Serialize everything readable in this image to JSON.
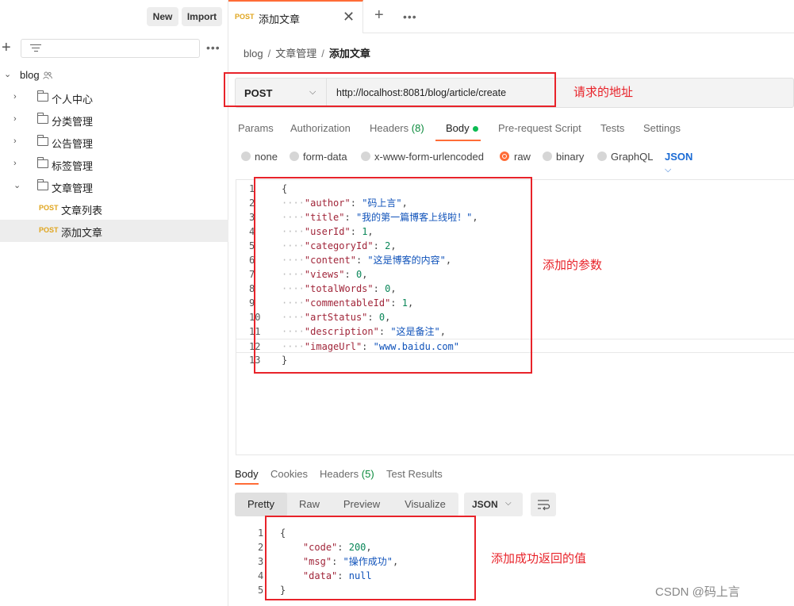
{
  "sidebar": {
    "new_label": "New",
    "import_label": "Import",
    "more": "•••",
    "collection": "blog",
    "folders": [
      "个人中心",
      "分类管理",
      "公告管理",
      "标签管理",
      "文章管理"
    ],
    "requests": [
      {
        "method": "POST",
        "name": "文章列表"
      },
      {
        "method": "POST",
        "name": "添加文章"
      }
    ]
  },
  "tab": {
    "method": "POST",
    "title": "添加文章",
    "close": "✕",
    "add": "+",
    "more": "•••"
  },
  "breadcrumb": [
    "blog",
    "文章管理",
    "添加文章"
  ],
  "breadcrumb_sep": "/",
  "request": {
    "method": "POST",
    "url": "http://localhost:8081/blog/article/create",
    "tabs": [
      "Params",
      "Authorization",
      "Headers",
      "Body",
      "Pre-request Script",
      "Tests",
      "Settings"
    ],
    "headers_count": "(8)",
    "body_types": [
      "none",
      "form-data",
      "x-www-form-urlencoded",
      "raw",
      "binary",
      "GraphQL"
    ],
    "selected_body_type": "raw",
    "body_format": "JSON"
  },
  "request_body": [
    {
      "n": "1",
      "text": "{"
    },
    {
      "n": "2",
      "key": "author",
      "val": "\"码上言\"",
      "type": "s"
    },
    {
      "n": "3",
      "key": "title",
      "val": "\"我的第一篇博客上线啦！\"",
      "type": "s"
    },
    {
      "n": "4",
      "key": "userId",
      "val": "1",
      "type": "n"
    },
    {
      "n": "5",
      "key": "categoryId",
      "val": "2",
      "type": "n"
    },
    {
      "n": "6",
      "key": "content",
      "val": "\"这是博客的内容\"",
      "type": "s"
    },
    {
      "n": "7",
      "key": "views",
      "val": "0",
      "type": "n"
    },
    {
      "n": "8",
      "key": "totalWords",
      "val": "0",
      "type": "n"
    },
    {
      "n": "9",
      "key": "commentableId",
      "val": "1",
      "type": "n"
    },
    {
      "n": "10",
      "key": "artStatus",
      "val": "0",
      "type": "n"
    },
    {
      "n": "11",
      "key": "description",
      "val": "\"这是备注\"",
      "type": "s"
    },
    {
      "n": "12",
      "key": "imageUrl",
      "val": "\"www.baidu.com\"",
      "type": "s",
      "last": true
    },
    {
      "n": "13",
      "text": "}"
    }
  ],
  "response": {
    "tabs": [
      "Body",
      "Cookies",
      "Headers",
      "Test Results"
    ],
    "headers_count": "(5)",
    "views": [
      "Pretty",
      "Raw",
      "Preview",
      "Visualize"
    ],
    "format": "JSON",
    "lines": [
      {
        "n": "1",
        "text": "{"
      },
      {
        "n": "2",
        "key": "code",
        "val": "200",
        "type": "n"
      },
      {
        "n": "3",
        "key": "msg",
        "val": "\"操作成功\"",
        "type": "s"
      },
      {
        "n": "4",
        "key": "data",
        "val": "null",
        "type": "kw",
        "last": true
      },
      {
        "n": "5",
        "text": "}"
      }
    ]
  },
  "annotations": {
    "url": "请求的地址",
    "params": "添加的参数",
    "response": "添加成功返回的值"
  },
  "watermark": "CSDN @码上言"
}
